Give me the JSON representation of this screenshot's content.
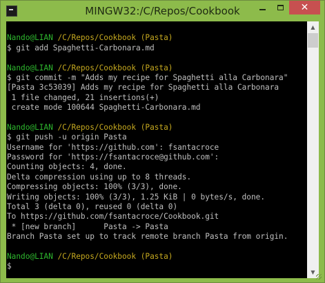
{
  "window": {
    "title": "MINGW32:/C/Repos/Cookbook",
    "controls": {
      "minimize_glyph": "—",
      "maximize_glyph": "□",
      "close_glyph": "✕"
    }
  },
  "terminal": {
    "prompt": {
      "user": "Nando@LIAN",
      "path": "/C/Repos/Cookbook",
      "branch": "(Pasta)"
    },
    "commands": [
      "$ git add Spaghetti-Carbonara.md",
      "$ git commit -m \"Adds my recipe for Spaghetti alla Carbonara\"",
      "$ git push -u origin Pasta",
      "$"
    ],
    "commit_output": [
      "[Pasta 3c53039] Adds my recipe for Spaghetti alla Carbonara",
      " 1 file changed, 21 insertions(+)",
      " create mode 100644 Spaghetti-Carbonara.md"
    ],
    "push_output": [
      "Username for 'https://github.com': fsantacroce",
      "Password for 'https://fsantacroce@github.com':",
      "Counting objects: 4, done.",
      "Delta compression using up to 8 threads.",
      "Compressing objects: 100% (3/3), done.",
      "Writing objects: 100% (3/3), 1.25 KiB | 0 bytes/s, done.",
      "Total 3 (delta 0), reused 0 (delta 0)",
      "To https://github.com/fsantacroce/Cookbook.git",
      " * [new branch]      Pasta -> Pasta",
      "Branch Pasta set up to track remote branch Pasta from origin."
    ],
    "colors": {
      "user": "#2eb82e",
      "path": "#c6a91f",
      "text": "#c0c0c0",
      "background": "#000000"
    }
  },
  "scrollbar": {
    "up_glyph": "▲",
    "down_glyph": "▼"
  }
}
